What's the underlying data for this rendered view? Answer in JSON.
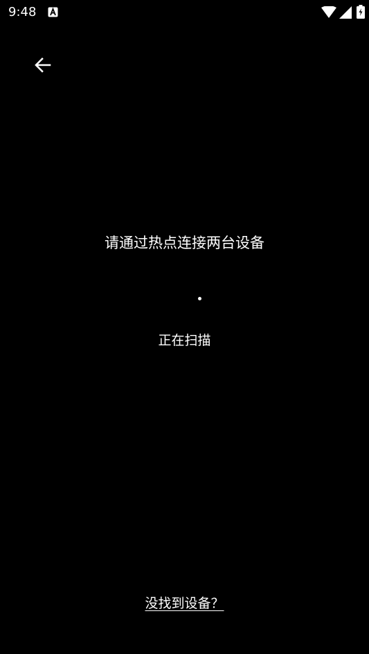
{
  "status_bar": {
    "time": "9:48",
    "notification_icon": "a-box-icon",
    "wifi_icon": "wifi-icon",
    "signal_icon": "signal-icon",
    "battery_icon": "battery-charging-icon"
  },
  "header": {
    "back_icon": "arrow-left-icon"
  },
  "main": {
    "instruction": "请通过热点连接两台设备",
    "scan_status": "正在扫描"
  },
  "footer": {
    "not_found_link": "没找到设备？"
  },
  "colors": {
    "background": "#000000",
    "text": "#ffffff"
  }
}
